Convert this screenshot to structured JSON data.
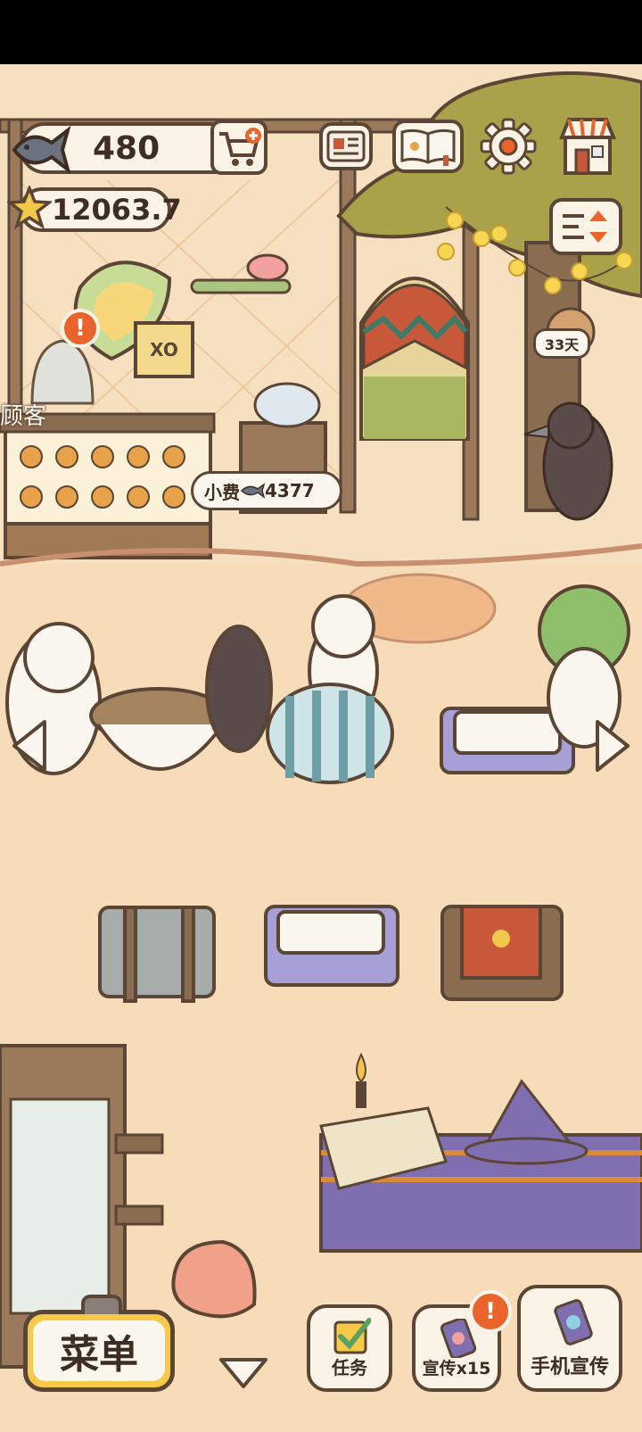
{
  "hud": {
    "fish_count": "480",
    "star_score": "12063.7"
  },
  "scene": {
    "customer_label": "顾客",
    "tip_bubble": {
      "label": "小费",
      "amount": "4377"
    },
    "event_days": "33天"
  },
  "bottom_bar": {
    "menu_label": "菜单",
    "tasks_label": "任务",
    "promote_label": "宣传x15",
    "phone_promote_label": "手机宣传"
  },
  "badges": {
    "alert": "!"
  },
  "colors": {
    "background": "#f6dcb8",
    "outline": "#5b4535",
    "panel": "#fbf3e6",
    "menu_button": "#f7c948",
    "alert": "#e9642a",
    "tree": "#a9a24a"
  },
  "icons": [
    "fish-icon",
    "cart-plus-icon",
    "star-icon",
    "news-icon",
    "recipe-book-icon",
    "gear-icon",
    "shop-icon",
    "sort-toggle-icon",
    "arrow-left-icon",
    "arrow-right-icon",
    "chevron-down-icon",
    "checklist-icon",
    "phone-icon"
  ]
}
